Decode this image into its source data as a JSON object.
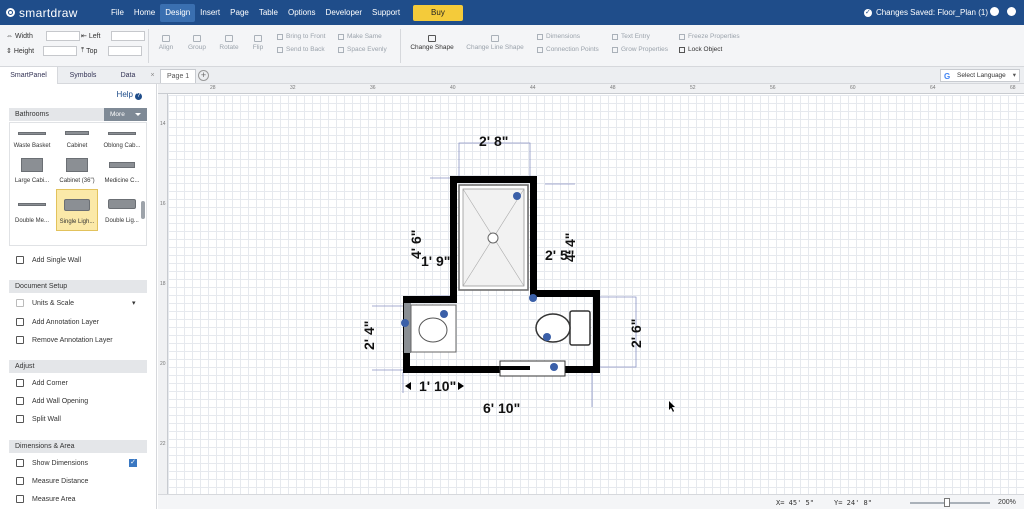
{
  "app": {
    "logo": "smartdraw"
  },
  "menu": {
    "items": [
      "File",
      "Home",
      "Design",
      "Insert",
      "Page",
      "Table",
      "Options",
      "Developer",
      "Support"
    ],
    "active": "Design",
    "buy_label": "Buy"
  },
  "status": {
    "saved_text": "Changes Saved: Floor_Plan (1)"
  },
  "ribbon": {
    "width_label": "Width",
    "height_label": "Height",
    "left_label": "Left",
    "top_label": "Top",
    "align": "Align",
    "group": "Group",
    "rotate": "Rotate",
    "flip": "Flip",
    "bring_front": "Bring to Front",
    "send_back": "Send to Back",
    "make_same": "Make Same",
    "space_evenly": "Space Evenly",
    "change_shape": "Change Shape",
    "change_line_shape": "Change Line Shape",
    "dimensions": "Dimensions",
    "connection_points": "Connection Points",
    "text_entry": "Text Entry",
    "grow_properties": "Grow Properties",
    "freeze_properties": "Freeze Properties",
    "lock_object": "Lock Object"
  },
  "panel_tabs": [
    "SmartPanel",
    "Symbols",
    "Data"
  ],
  "page_tab": "Page 1",
  "language": "Select Language",
  "sidebar": {
    "help": "Help",
    "library": "Bathrooms",
    "more": "More",
    "shapes": [
      "Waste Basket",
      "Cabinet",
      "Oblong Cab...",
      "Large Cabi...",
      "Cabinet (36\")",
      "Medicine C...",
      "Double Me...",
      "Single Ligh...",
      "Double Lig..."
    ],
    "add_single_wall": "Add Single Wall",
    "document_setup": "Document Setup",
    "units_scale": "Units & Scale",
    "add_annotation": "Add Annotation Layer",
    "remove_annotation": "Remove Annotation Layer",
    "adjust": "Adjust",
    "add_corner": "Add Corner",
    "add_wall_opening": "Add Wall Opening",
    "split_wall": "Split Wall",
    "dimensions_area": "Dimensions & Area",
    "show_dimensions": "Show Dimensions",
    "measure_distance": "Measure Distance",
    "measure_area": "Measure Area"
  },
  "ruler": {
    "top": [
      "28",
      "32",
      "36",
      "40",
      "44",
      "48",
      "52",
      "56",
      "60",
      "64",
      "68",
      "72"
    ],
    "left": [
      "14",
      "16",
      "18",
      "20",
      "22",
      "24",
      "26"
    ]
  },
  "plan": {
    "dims": [
      "2' 8\"",
      "4' 6\"",
      "1' 9\"",
      "2' 5\"",
      "4' 4\"",
      "2' 4\"",
      "2' 6\"",
      "1' 10\"",
      "6' 10\""
    ]
  },
  "statusbar": {
    "x": "X=  45' 5\"",
    "y": "Y=  24' 8\"",
    "zoom": "200%"
  }
}
